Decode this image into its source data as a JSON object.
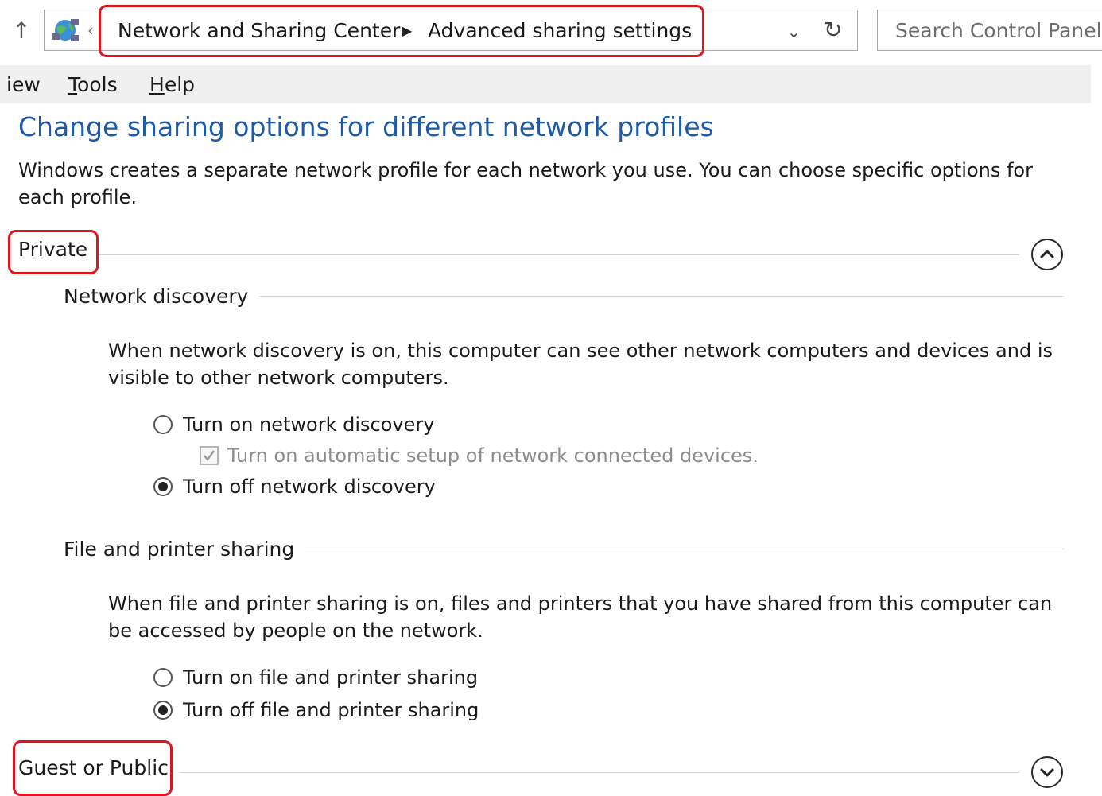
{
  "address_bar": {
    "breadcrumb": [
      "Network and Sharing Center",
      "Advanced sharing settings"
    ],
    "separator": "▶",
    "back_chevron": "‹",
    "dropdown_glyph": "⌄",
    "refresh_glyph": "↻",
    "up_glyph": "↑",
    "search_placeholder": "Search Control Panel"
  },
  "menu": {
    "view": {
      "prefix": "iew",
      "accel": "",
      "rest": ""
    },
    "tools": {
      "accel": "T",
      "rest": "ools"
    },
    "help": {
      "accel": "H",
      "rest": "elp"
    }
  },
  "page": {
    "title": "Change sharing options for different network profiles",
    "description": "Windows creates a separate network profile for each network you use. You can choose specific options for each profile."
  },
  "profiles": {
    "private": {
      "title": "Private",
      "expanded": true,
      "network_discovery": {
        "title": "Network discovery",
        "description": "When network discovery is on, this computer can see other network computers and devices and is visible to other network computers.",
        "option_on": "Turn on network discovery",
        "auto_setup": "Turn on automatic setup of network connected devices.",
        "option_off": "Turn off network discovery",
        "selected": "off",
        "auto_setup_checked": true,
        "auto_setup_enabled": false
      },
      "file_printer_sharing": {
        "title": "File and printer sharing",
        "description": "When file and printer sharing is on, files and printers that you have shared from this computer can be accessed by people on the network.",
        "option_on": "Turn on file and printer sharing",
        "option_off": "Turn off file and printer sharing",
        "selected": "off"
      }
    },
    "guest": {
      "title": "Guest or Public",
      "expanded": false
    }
  },
  "colors": {
    "title_blue": "#1e5aa8",
    "highlight_red": "#e0141e",
    "menu_bg": "#f0f0f0"
  },
  "icons": {
    "up": "up-arrow-icon",
    "network": "network-globe-icon",
    "collapse": "chevron-up-icon",
    "expand": "chevron-down-icon",
    "refresh": "refresh-icon",
    "dropdown": "dropdown-arrow-icon"
  }
}
